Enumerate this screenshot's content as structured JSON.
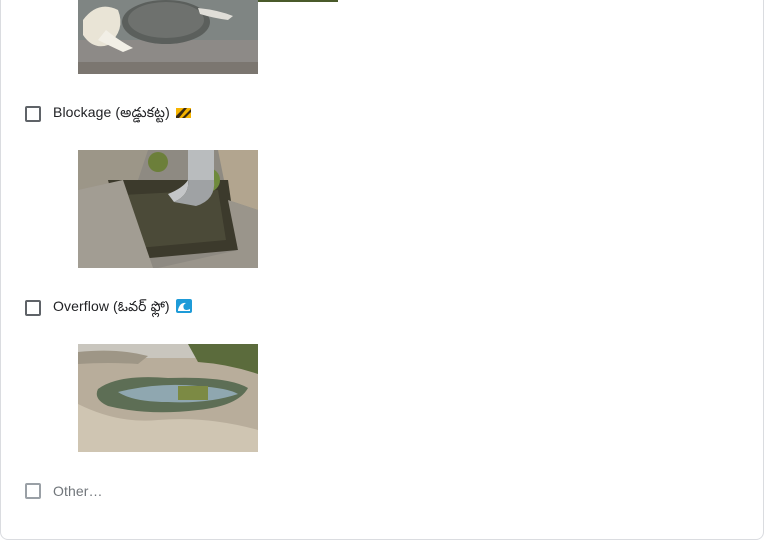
{
  "options": [
    {
      "label": "Blockage (అడ్డుకట్ట)",
      "icon": "construction-icon"
    },
    {
      "label": "Overflow (ఓవర్ ఫ్లో)",
      "icon": "water-wave-icon"
    },
    {
      "label": "Other…"
    }
  ],
  "colors": {
    "accent": "#4a5a2a",
    "checkbox_border": "#5f6368",
    "text": "#202124"
  }
}
